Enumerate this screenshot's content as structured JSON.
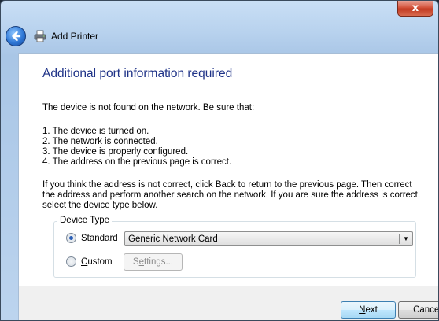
{
  "window": {
    "close_label": "x"
  },
  "navbar": {
    "title": "Add Printer"
  },
  "main": {
    "heading": "Additional port information required",
    "intro": "The device is not found on the network.  Be sure that:",
    "steps": [
      "1.  The device is turned on.",
      "2.  The network is connected.",
      "3.  The device is properly configured.",
      "4.  The address on the previous page is correct."
    ],
    "explanation": "If you think the address is not correct, click Back to return to the previous page.  Then correct the address and perform another search on the network.  If you are sure the address is correct, select the device type below."
  },
  "device_type": {
    "legend": "Device Type",
    "standard": {
      "hotkey": "S",
      "rest": "tandard",
      "selected": true
    },
    "custom": {
      "hotkey": "C",
      "rest": "ustom",
      "selected": false
    },
    "standard_value": "Generic Network Card",
    "settings": {
      "pre": "S",
      "hotkey": "e",
      "rest": "ttings..."
    }
  },
  "footer": {
    "next": {
      "hotkey": "N",
      "rest": "ext"
    },
    "cancel": "Cancel"
  }
}
